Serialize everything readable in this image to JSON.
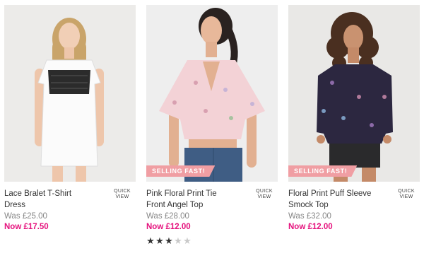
{
  "products": [
    {
      "title_line1": "Lace Bralet T-Shirt",
      "title_line2": "Dress",
      "quick_view_line1": "QUICK",
      "quick_view_line2": "VIEW",
      "was_price": "Was £25.00",
      "now_price": "Now £17.50"
    },
    {
      "badge": "SELLING FAST!",
      "title_line1": "Pink Floral Print Tie",
      "title_line2": "Front Angel Top",
      "quick_view_line1": "QUICK",
      "quick_view_line2": "VIEW",
      "was_price": "Was £28.00",
      "now_price": "Now £12.00",
      "rating": 3,
      "rating_max": 5
    },
    {
      "badge": "SELLING FAST!",
      "title_line1": "Floral Print Puff Sleeve",
      "title_line2": "Smock Top",
      "quick_view_line1": "QUICK",
      "quick_view_line2": "VIEW",
      "was_price": "Was £32.00",
      "now_price": "Now £12.00"
    }
  ],
  "colors": {
    "sale_price": "#e5127d",
    "was_price": "#888888",
    "badge_bg": "#f09ea3"
  }
}
